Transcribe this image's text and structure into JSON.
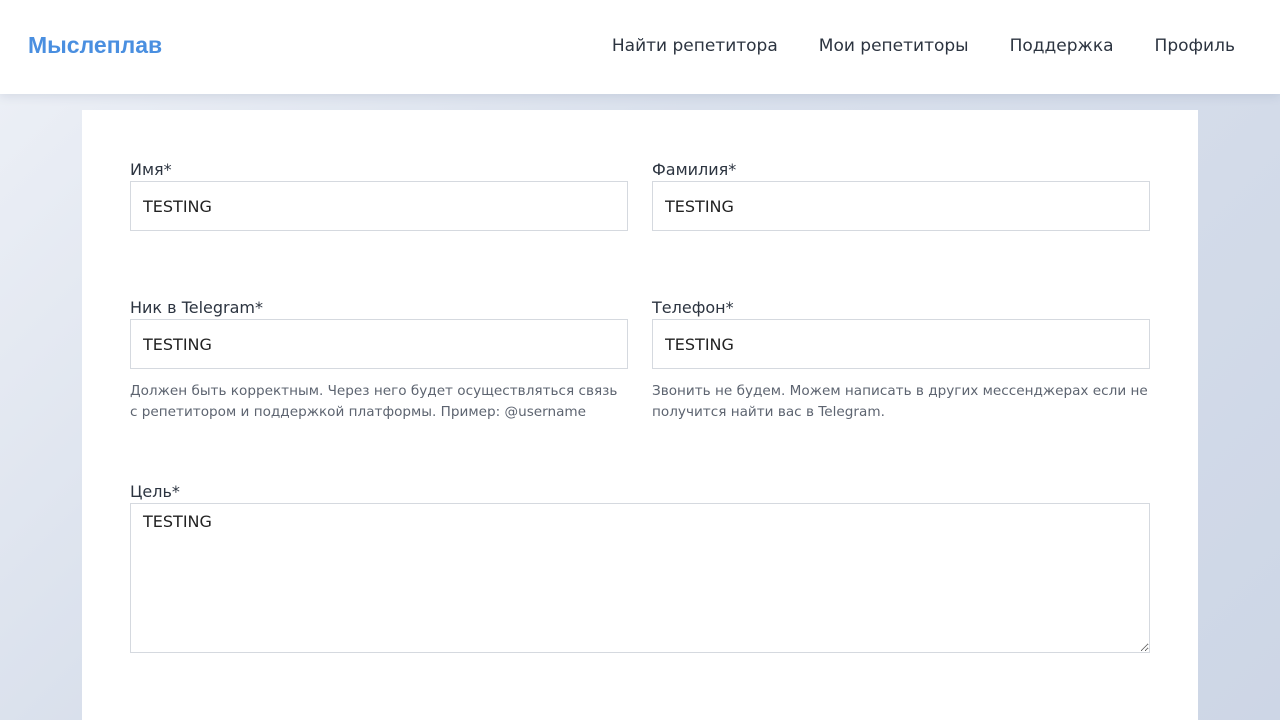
{
  "navbar": {
    "brand": "Мыслеплав",
    "links": [
      {
        "label": "Найти репетитора"
      },
      {
        "label": "Мои репетиторы"
      },
      {
        "label": "Поддержка"
      },
      {
        "label": "Профиль"
      }
    ]
  },
  "form": {
    "first_name": {
      "label": "Имя*",
      "value": "TESTING"
    },
    "last_name": {
      "label": "Фамилия*",
      "value": "TESTING"
    },
    "telegram": {
      "label": "Ник в Telegram*",
      "value": "TESTING",
      "hint": "Должен быть корректным. Через него будет осуществляться связь с репетитором и поддержкой платформы. Пример: @username"
    },
    "phone": {
      "label": "Телефон*",
      "value": "TESTING",
      "hint": "Звонить не будем. Можем написать в других мессенджерах если не получится найти вас в Telegram."
    },
    "goal": {
      "label": "Цель*",
      "value": "TESTING"
    }
  },
  "colors": {
    "brand": "#4a8fe0",
    "text": "#2c3440",
    "hint": "#5d6470",
    "border": "#d5d9df"
  }
}
